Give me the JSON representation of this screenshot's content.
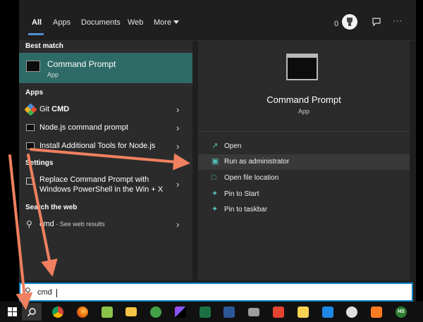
{
  "header": {
    "tabs": [
      {
        "label": "All",
        "active": true
      },
      {
        "label": "Apps"
      },
      {
        "label": "Documents"
      },
      {
        "label": "Web"
      },
      {
        "label": "More"
      }
    ],
    "points": "0",
    "feedback_icon": "feedback-icon",
    "more_options": "···"
  },
  "left": {
    "best_match_title": "Best match",
    "best_match": {
      "name": "Command Prompt",
      "type": "App"
    },
    "apps_title": "Apps",
    "apps": [
      {
        "pre": "Git ",
        "bold": "CMD"
      },
      {
        "label": "Node.js command prompt"
      },
      {
        "label": "Install Additional Tools for Node.js"
      }
    ],
    "settings_title": "Settings",
    "settings_item": {
      "line1": "Replace Command Prompt with",
      "line2": "Windows PowerShell in the Win + X"
    },
    "web_title": "Search the web",
    "web_item": {
      "query": "cmd",
      "suffix": " - See web results"
    }
  },
  "right": {
    "app_name": "Command Prompt",
    "app_type": "App",
    "actions": [
      {
        "label": "Open",
        "icon": "open-icon"
      },
      {
        "label": "Run as administrator",
        "icon": "shield-icon"
      },
      {
        "label": "Open file location",
        "icon": "file-icon"
      },
      {
        "label": "Pin to Start",
        "icon": "pin-icon"
      },
      {
        "label": "Pin to taskbar",
        "icon": "pin-icon"
      }
    ]
  },
  "search": {
    "value": "cmd"
  },
  "taskbar": {
    "hs_label": "HS",
    "apps": [
      "chrome",
      "firefox",
      "notepad-plus",
      "file-explorer",
      "xbox",
      "phpstorm",
      "excel",
      "word",
      "printer",
      "todoist",
      "sticky",
      "calendar",
      "vpn",
      "xampp",
      "hs-app"
    ]
  },
  "colors": {
    "accent": "#2e6b66",
    "arrow": "#f08060",
    "link": "#4fc3b8"
  }
}
